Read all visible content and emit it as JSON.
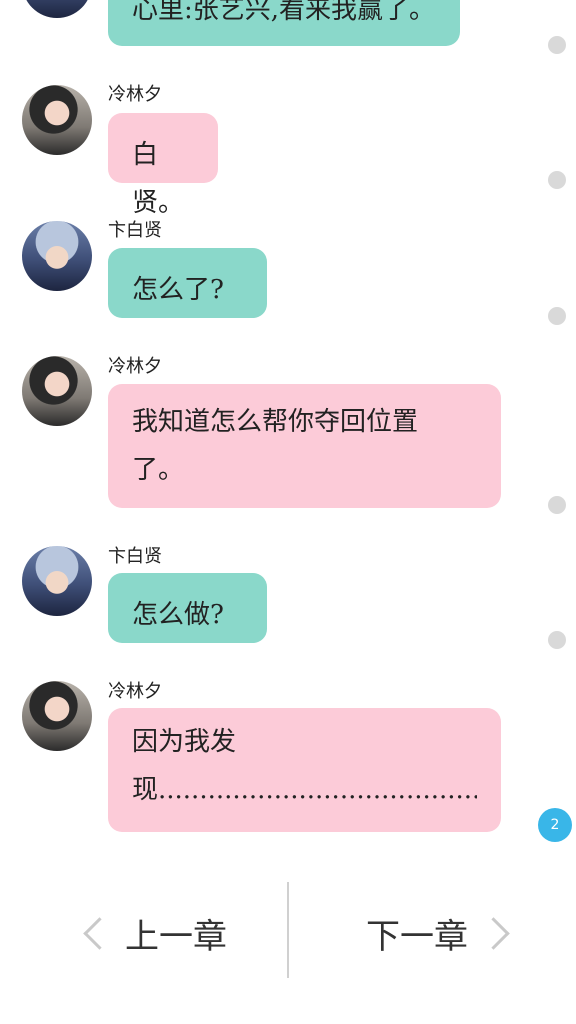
{
  "messages": [
    {
      "speaker": "",
      "text": "心里:张艺兴,看来我赢了。",
      "color": "teal"
    },
    {
      "speaker": "冷林夕",
      "text": "白贤。",
      "color": "pink"
    },
    {
      "speaker": "卞白贤",
      "text": "怎么了?",
      "color": "teal"
    },
    {
      "speaker": "冷林夕",
      "line1": "我知道怎么帮你夺回位置",
      "line2": "了。",
      "color": "pink"
    },
    {
      "speaker": "卞白贤",
      "text": "怎么做?",
      "color": "teal"
    },
    {
      "speaker": "冷林夕",
      "line1": "因为我发",
      "line2": "现..............................................",
      "color": "pink"
    }
  ],
  "badge": {
    "count": "2"
  },
  "nav": {
    "prev_label": "上一章",
    "next_label": "下一章"
  },
  "colors": {
    "teal_bubble": "#8ad8ca",
    "pink_bubble": "#fccbd8",
    "badge": "#39b6e8"
  }
}
